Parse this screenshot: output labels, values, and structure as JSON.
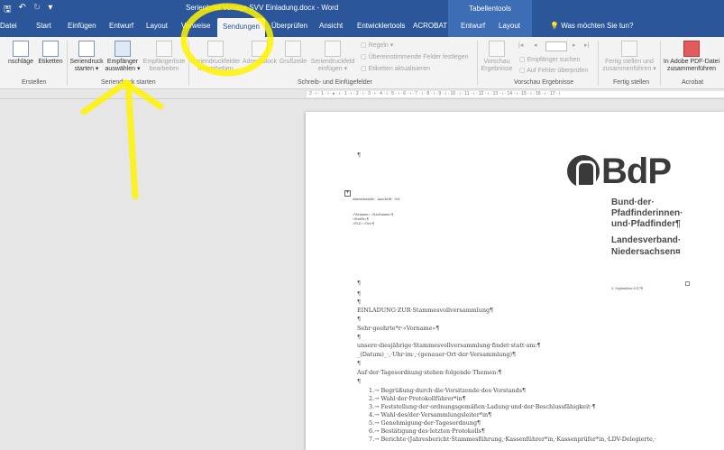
{
  "titlebar": {
    "title": "Serienbrief Vorlage SVV Einladung.docx - Word",
    "contextual_group": "Tabellentools"
  },
  "tabs": [
    {
      "label": "Datei"
    },
    {
      "label": "Start"
    },
    {
      "label": "Einfügen"
    },
    {
      "label": "Entwurf"
    },
    {
      "label": "Layout"
    },
    {
      "label": "Verweise"
    },
    {
      "label": "Sendungen"
    },
    {
      "label": "Überprüfen"
    },
    {
      "label": "Ansicht"
    },
    {
      "label": "Entwicklertools"
    },
    {
      "label": "ACROBAT"
    },
    {
      "label": "Entwurf"
    },
    {
      "label": "Layout"
    }
  ],
  "tellme": "Was möchten Sie tun?",
  "ribbon": {
    "erstellen": {
      "envelopes": "nschläge",
      "labels": "Etiketten",
      "group": "Erstellen"
    },
    "start": {
      "start_merge_1": "Seriendruck",
      "start_merge_2": "starten",
      "select_recipients_1": "Empfänger",
      "select_recipients_2": "auswählen",
      "edit_list_1": "Empfängerliste",
      "edit_list_2": "bearbeiten",
      "group": "Seriendruck starten"
    },
    "fields": {
      "highlight_1": "Seriendruckfelder",
      "highlight_2": "hervorheben",
      "address_block": "Adressblock",
      "greeting": "Grußzeile",
      "insert_field_1": "Seriendruckfeld",
      "insert_field_2": "einfügen",
      "rules": "Regeln",
      "match_fields": "Übereinstimmende Felder festlegen",
      "update_labels": "Etiketten aktualisieren",
      "group": "Schreib- und Einfügefelder"
    },
    "preview": {
      "preview_1": "Vorschau",
      "preview_2": "Ergebnisse",
      "find_recipient": "Empfänger suchen",
      "check_errors": "Auf Fehler überprüfen",
      "group": "Vorschau Ergebnisse"
    },
    "finish": {
      "finish_1": "Fertig stellen und",
      "finish_2": "zusammenführen",
      "group": "Fertig stellen"
    },
    "acrobat": {
      "pdf_1": "In Adobe PDF-Datei",
      "pdf_2": "zusammenführen",
      "group": "Acrobat"
    }
  },
  "ruler": {
    "scale": "· 2 · ı · 1 · ı · ▸ · ı · 1 · ı · 2 · ı · 3 · ı · 4 · ı · 5 · ı · 6 · ı · 7 · ı · 8 · ı · 9 · ı · 10 · ı · 11 · ı · 12 · ı · 13 · ı · 14 · ı · 15 · ı · 16 · ı · 17 · ı"
  },
  "document": {
    "logo": "BdP",
    "org_lines": [
      "Bund·der·",
      "Pfadfinderinnen·",
      "und·Pfadfinder¶",
      "Landesverband·",
      "Niedersachsen¤"
    ],
    "para_mark": "¶",
    "sender": "Absenderzeile · Anschrift · Ort",
    "address_lines": [
      "«Vorname»·«Nachname»¶",
      "«Straße»¶",
      "«PLZ»·«Ort»¶"
    ],
    "date": "5.·September·2017¶",
    "heading": "EINLADUNG·ZUR·Stammesvollversammlung¶",
    "salutation": "Sehr·geehrte*r·«Vorname»¶",
    "body": [
      "unsere·diesjährige·Stammesvollversammlung·findet·statt·am:¶",
      "_(Datum)_·,·Uhr·im·,·(genauer·Ort·der·Versammlung)¶",
      "Auf·der·Tagesordnung·stehen·folgende·Themen:¶"
    ],
    "agenda": [
      "1.→ Begrüßung·durch·die·Vorsitzende·des·Vorstands¶",
      "2.→ Wahl·der·Protokollführer*in¶",
      "3.→ Feststellung·der·ordnungsgemäßen·Ladung·und·der·Beschlussfähigkeit·¶",
      "4.→ Wahl·des/der·Versammlungsleiter*in¶",
      "5.→ Genehmigung·der·Tagesordnung¶",
      "6.→ Bestätigung·des·letzten·Protokolls¶",
      "7.→ Berichte·(Jahresbericht·Stammesführung,·Kassenführer*in,·Kassenprüfer*in,·LDV-Delegierte,·"
    ]
  },
  "colors": {
    "word_blue": "#2b579a",
    "highlight": "#fff200",
    "contextual": "#3d6db5"
  }
}
